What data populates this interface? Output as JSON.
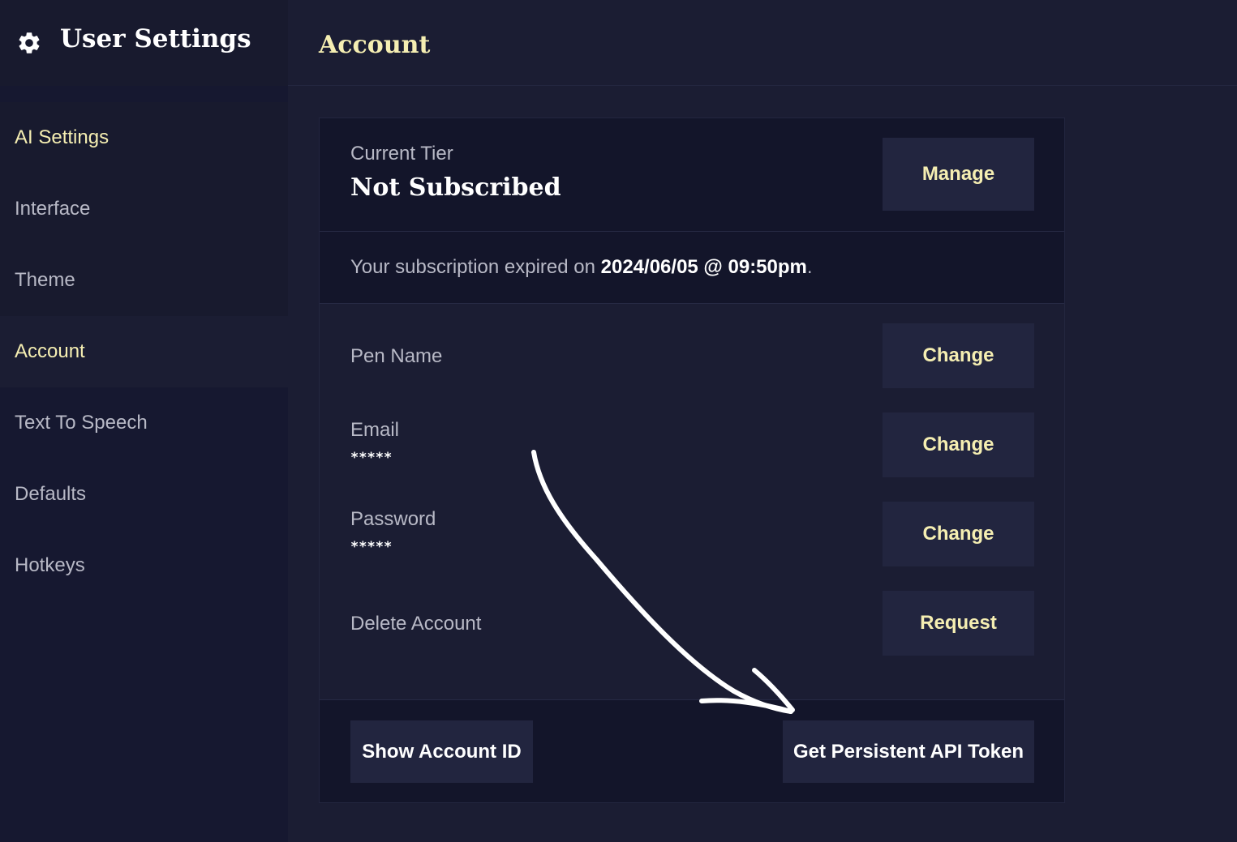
{
  "sidebar": {
    "title": "User Settings",
    "items": [
      {
        "label": "AI Settings"
      },
      {
        "label": "Interface"
      },
      {
        "label": "Theme"
      },
      {
        "label": "Account"
      },
      {
        "label": "Text To Speech"
      },
      {
        "label": "Defaults"
      },
      {
        "label": "Hotkeys"
      }
    ]
  },
  "main": {
    "title": "Account",
    "tier": {
      "label": "Current Tier",
      "value": "Not Subscribed",
      "manage_label": "Manage"
    },
    "expiry": {
      "prefix": "Your subscription expired on",
      "date": "2024/06/05 @ 09:50pm",
      "suffix": "."
    },
    "fields": {
      "pen_name": {
        "label": "Pen Name",
        "button": "Change"
      },
      "email": {
        "label": "Email",
        "value": "*****",
        "button": "Change"
      },
      "password": {
        "label": "Password",
        "value": "*****",
        "button": "Change"
      },
      "delete_account": {
        "label": "Delete Account",
        "button": "Request"
      }
    },
    "footer": {
      "show_account_id": "Show Account ID",
      "get_token": "Get Persistent API Token"
    }
  },
  "colors": {
    "background": "#1b1d33",
    "sidebar": "#161830",
    "accent": "#f5eeb2",
    "button": "#22253f"
  },
  "icons": {
    "header": "gear-icon",
    "annotation": "hand-drawn-arrow-icon"
  }
}
